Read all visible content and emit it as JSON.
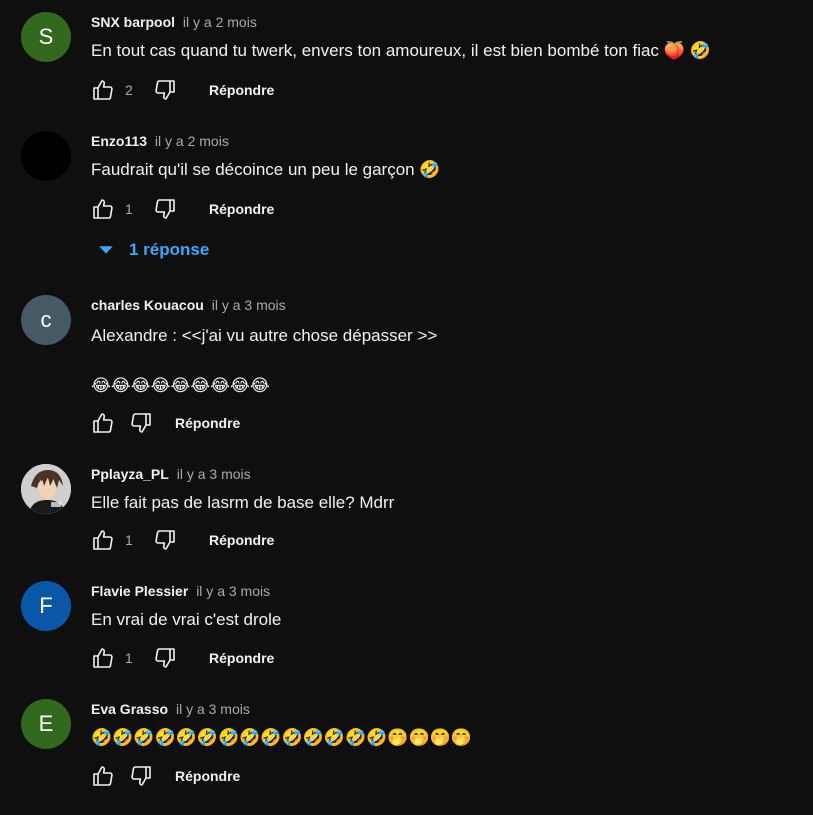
{
  "labels": {
    "reply": "Répondre"
  },
  "comments": [
    {
      "author": "SNX barpool",
      "time": "il y a 2 mois",
      "text": "En tout cas quand tu twerk, envers ton amoureux, il est bien bombé ton fiac 🍑 🤣",
      "likes": "2",
      "avatar_letter": "S",
      "avatar_color": "#33691e"
    },
    {
      "author": "Enzo113",
      "time": "il y a 2 mois",
      "text": "Faudrait qu'il se décoince un peu le garçon 🤣",
      "likes": "1",
      "avatar_letter": "",
      "avatar_color": "#000000",
      "replies": "1 réponse"
    },
    {
      "author": "charles Kouacou",
      "time": "il y a 3 mois",
      "text": "Alexandre : <<j'ai vu autre chose dépasser >>\n\n😂😂😂😂😂😂😂😂😂",
      "likes": "",
      "avatar_letter": "c",
      "avatar_color": "#455a64"
    },
    {
      "author": "Pplayza_PL",
      "time": "il y a 3 mois",
      "text": "Elle fait pas de lasrm de base elle? Mdrr",
      "likes": "1",
      "avatar_letter": "",
      "avatar_color": "#d8d8d8"
    },
    {
      "author": "Flavie Plessier",
      "time": "il y a 3 mois",
      "text": "En vrai de vrai c'est drole",
      "likes": "1",
      "avatar_letter": "F",
      "avatar_color": "#0b57a7"
    },
    {
      "author": "Eva Grasso",
      "time": "il y a 3 mois",
      "text": "🤣🤣🤣🤣🤣🤣🤣🤣🤣🤣🤣🤣🤣🤣🤭🤭🤭🤭",
      "likes": "",
      "avatar_letter": "E",
      "avatar_color": "#33691e"
    }
  ]
}
